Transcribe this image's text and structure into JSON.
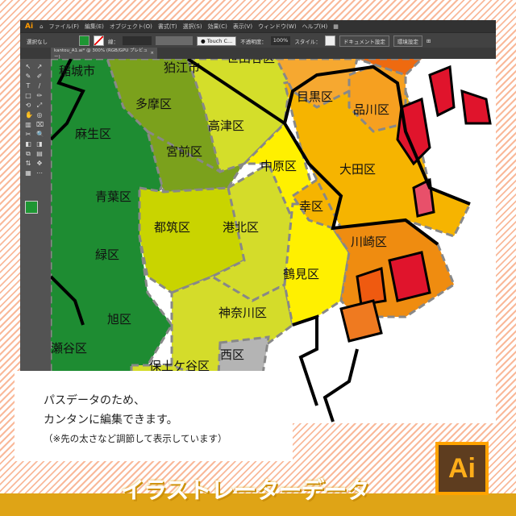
{
  "app": {
    "logo": "Ai",
    "menu": [
      "ファイル(F)",
      "編集(E)",
      "オブジェクト(O)",
      "書式(T)",
      "選択(S)",
      "効果(C)",
      "表示(V)",
      "ウィンドウ(W)",
      "ヘルプ(H)"
    ]
  },
  "control_bar": {
    "selection": "選択なし",
    "stroke_label": "線：",
    "brush": "Touch C...",
    "opacity_label": "不透明度：",
    "opacity": "100%",
    "style_label": "スタイル：",
    "document_settings": "ドキュメント設定",
    "preferences": "環境設定",
    "fill_color": "#1e9633"
  },
  "tab": {
    "title": "kantou_A1.ai* @ 300% (RGB/GPU プレビュー)",
    "close": "×"
  },
  "map_labels": [
    "稲城市",
    "狛江市",
    "世田谷区",
    "多摩区",
    "麻生区",
    "高津区",
    "目黒区",
    "品川区",
    "宮前区",
    "中原区",
    "大田区",
    "青葉区",
    "幸区",
    "都筑区",
    "港北区",
    "川崎区",
    "緑区",
    "鶴見区",
    "旭区",
    "神奈川区",
    "瀬谷区",
    "西区",
    "保土ケ谷区"
  ],
  "colors": {
    "green": "#1e8c32",
    "olive": "#7ba11c",
    "yellow_green": "#cdd81a",
    "yellow": "#fff000",
    "orange": "#f6b400",
    "dark_orange": "#ef8c10",
    "red": "#e0142c",
    "gray": "#b4b4b4",
    "band": "#dfa416"
  },
  "info": {
    "line1": "パスデータのため、",
    "line2": "カンタンに編集できます。",
    "note": "（※先の太さなど調節して表示しています）"
  },
  "headline": "イラストレーターデータ",
  "badge": "Ai"
}
